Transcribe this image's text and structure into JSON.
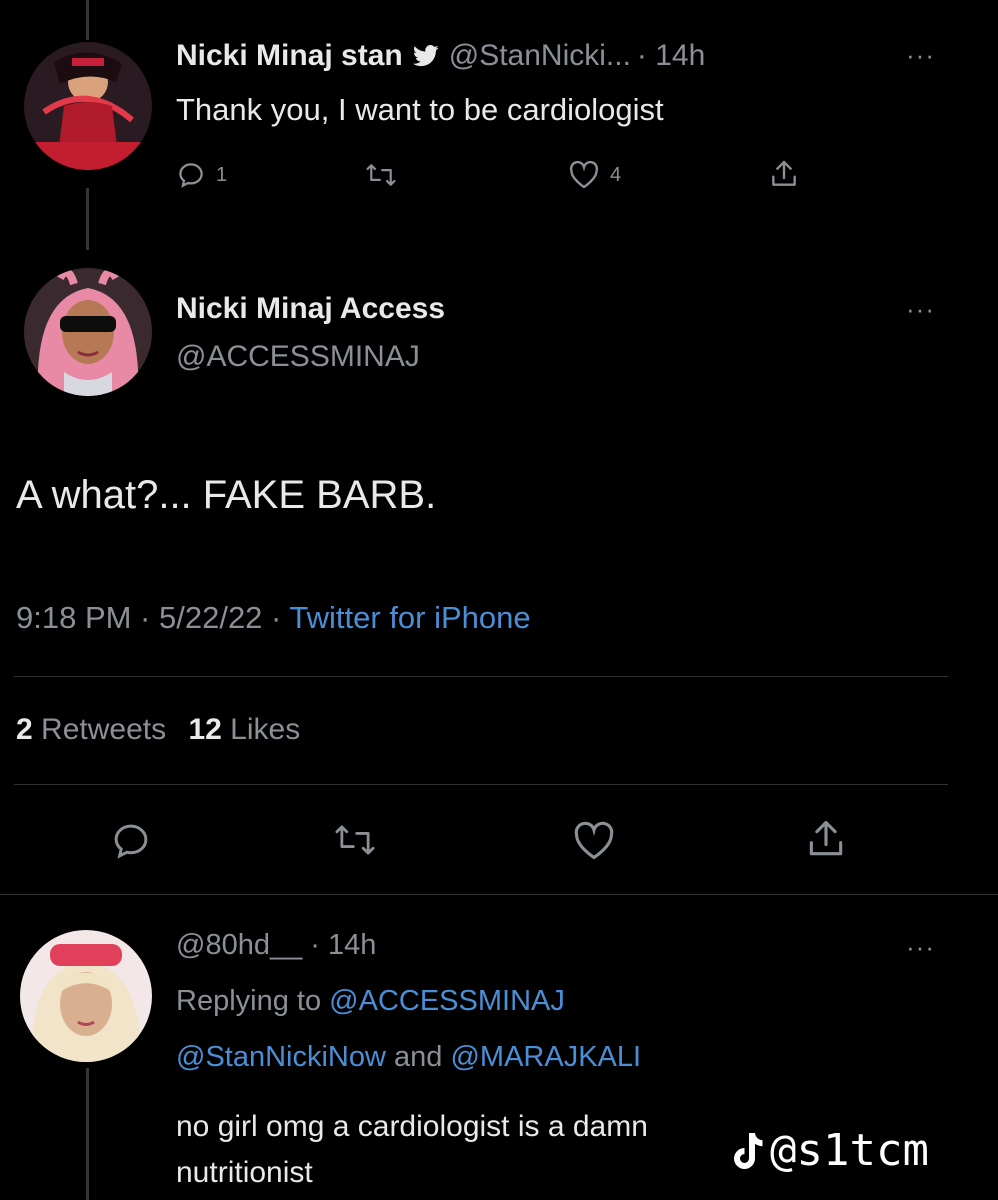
{
  "reply_to_tweet": {
    "author_name": "Nicki Minaj stan",
    "verified_icon": "twitter-bird-icon",
    "handle": "@StanNicki...",
    "time": "· 14h",
    "text": "Thank you, I want to be cardiologist",
    "reply_count": "1",
    "like_count": "4"
  },
  "main_tweet": {
    "author_name": "Nicki Minaj Access",
    "handle": "@ACCESSMINAJ",
    "text": "A what?... FAKE BARB.",
    "timestamp": "9:18 PM · 5/22/22 · ",
    "source": "Twitter for iPhone",
    "retweets_count": "2",
    "retweets_label": "Retweets",
    "likes_count": "12",
    "likes_label": "Likes"
  },
  "reply_tweet": {
    "handle": "@80hd__",
    "time": "· 14h",
    "replying_label": "Replying to",
    "replying_handle": "@ACCESSMINAJ",
    "mention_1": "@StanNickiNow",
    "mention_and": "and",
    "mention_2": "@MARAJKALI",
    "text_line1": "no girl omg a cardiologist is a damn",
    "text_line2": "nutritionist"
  },
  "watermark": {
    "icon": "tiktok-note-icon",
    "handle": "@s1tcm"
  },
  "colors": {
    "background": "#000000",
    "text": "#e7e9ea",
    "muted": "#8b9096",
    "link": "#4a8fd6",
    "divider": "#2f3336"
  }
}
